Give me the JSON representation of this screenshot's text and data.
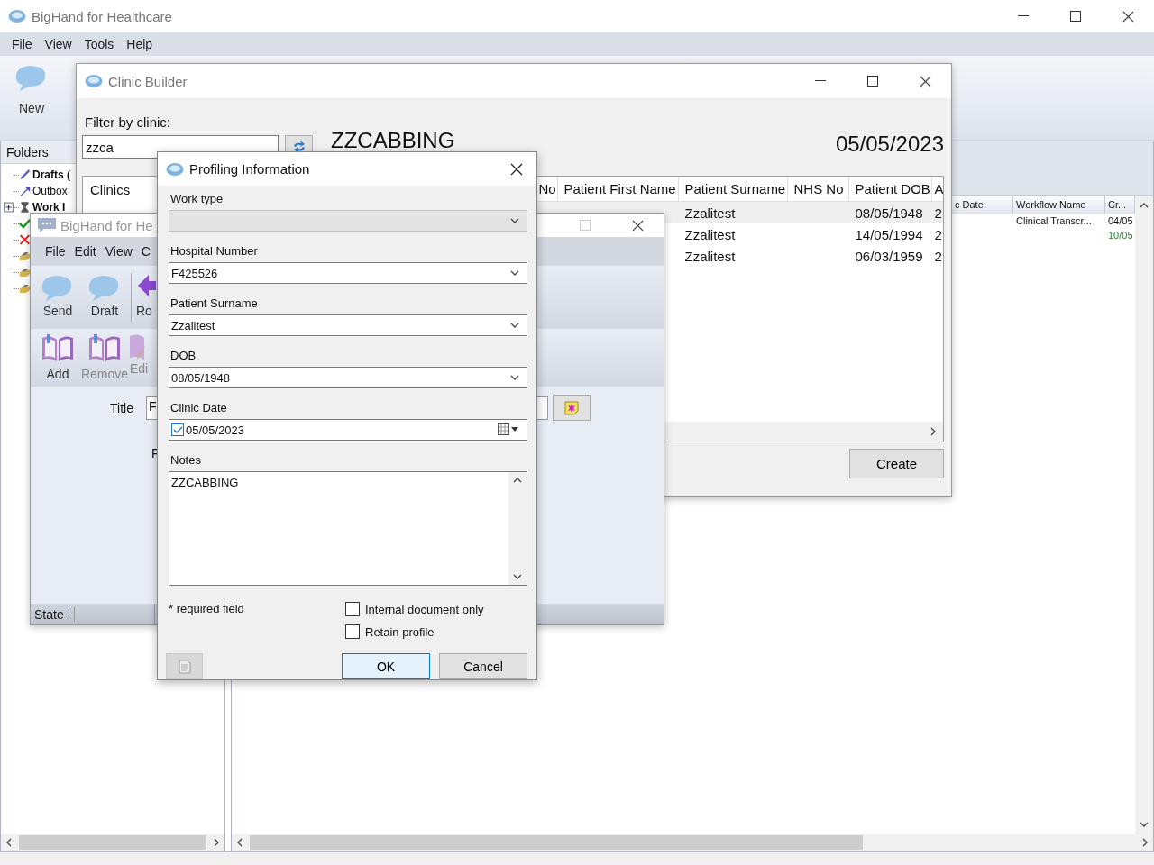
{
  "window": {
    "title": "BigHand for Healthcare"
  },
  "menu": [
    "File",
    "View",
    "Tools",
    "Help"
  ],
  "toolbar": [
    {
      "label": "New"
    }
  ],
  "folders": {
    "title": "Folders",
    "items": [
      {
        "kind": "drafts",
        "label": "Drafts (",
        "bold": true
      },
      {
        "kind": "outbox",
        "label": "Outbox",
        "bold": false
      },
      {
        "kind": "work",
        "label": "Work I",
        "bold": true,
        "expanded": false
      },
      {
        "kind": "done"
      },
      {
        "kind": "failed"
      },
      {
        "kind": "tray"
      },
      {
        "kind": "tray"
      },
      {
        "kind": "tray"
      }
    ]
  },
  "document_list": {
    "columns": [
      "c Date",
      "Workflow Name",
      "Cr..."
    ],
    "rows": [
      {
        "cells": [
          "",
          "Clinical Transcr...",
          "04/05"
        ],
        "highlighted": false
      },
      {
        "cells": [
          "",
          "",
          "10/05"
        ],
        "highlighted": true
      }
    ]
  },
  "clinic_builder": {
    "title": "Clinic Builder",
    "filter_label": "Filter by clinic:",
    "filter_value": "zzca",
    "clinic_name": "ZZCABBING",
    "clinic_date": "05/05/2023",
    "clinics_header": "Clinics",
    "table": {
      "columns": [
        "No",
        "Patient First Name",
        "Patient Surname",
        "NHS No",
        "Patient DOB",
        "A"
      ],
      "rows": [
        {
          "selected": true,
          "cells": [
            "",
            "",
            "Zzalitest",
            "",
            "08/05/1948",
            "2"
          ]
        },
        {
          "selected": false,
          "cells": [
            "",
            "",
            "Zzalitest",
            "",
            "14/05/1994",
            "2"
          ]
        },
        {
          "selected": false,
          "cells": [
            "",
            "",
            "Zzalitest",
            "",
            "06/03/1959",
            "2"
          ]
        }
      ]
    },
    "create_button": "Create"
  },
  "sub_window": {
    "title": "BigHand for He",
    "menu": [
      "File",
      "Edit",
      "View",
      "C"
    ],
    "toolbar_1": [
      {
        "kind": "send",
        "label": "Send",
        "disabled": false
      },
      {
        "kind": "draft",
        "label": "Draft",
        "disabled": false
      },
      {
        "kind": "route",
        "label": "Ro",
        "disabled": false
      }
    ],
    "toolbar_2": [
      {
        "kind": "add",
        "label": "Add",
        "disabled": false
      },
      {
        "kind": "remove",
        "label": "Remove",
        "disabled": true
      },
      {
        "kind": "edit",
        "label": "Edi",
        "disabled": true
      }
    ],
    "title_label": "Title",
    "title_value": "F",
    "second_label": "F",
    "status_label": "State :"
  },
  "dialog": {
    "title": "Profiling Information",
    "fields": [
      {
        "kind": "combo",
        "label": "Work type",
        "disabled": true
      },
      {
        "kind": "combo",
        "label": "Hospital Number",
        "value": "F425526",
        "disabled": false
      },
      {
        "kind": "combo",
        "label": "Patient Surname",
        "value": "Zzalitest",
        "disabled": false
      },
      {
        "kind": "combo",
        "label": "DOB",
        "value": "08/05/1948",
        "disabled": false
      },
      {
        "kind": "date",
        "label": "Clinic Date",
        "value": "05/05/2023",
        "checked": true,
        "disabled": false
      },
      {
        "kind": "notes",
        "label": "Notes",
        "value": "ZZCABBING",
        "disabled": false
      }
    ],
    "required_note": "* required field",
    "options": [
      {
        "label": "Internal document only",
        "checked": false
      },
      {
        "label": "Retain profile",
        "checked": false
      }
    ],
    "buttons": [
      {
        "label": "OK",
        "focused": true
      },
      {
        "label": "Cancel",
        "focused": false
      }
    ]
  }
}
